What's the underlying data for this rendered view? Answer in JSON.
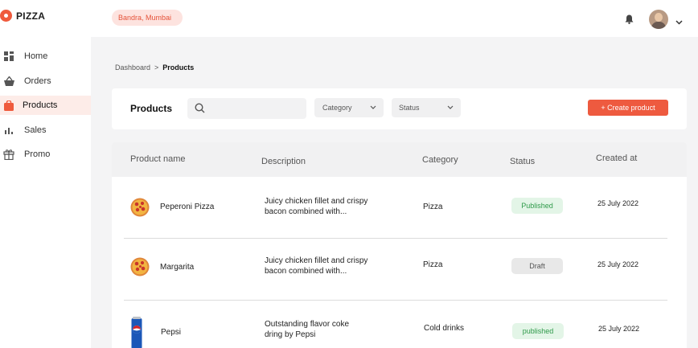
{
  "app": {
    "logo_text": "PIZZA",
    "brand_color": "#ef5a3c"
  },
  "sidebar": {
    "items": [
      {
        "label": "Home",
        "icon": "home-icon",
        "active": false
      },
      {
        "label": "Orders",
        "icon": "basket-icon",
        "active": false
      },
      {
        "label": "Products",
        "icon": "bag-icon",
        "active": true
      },
      {
        "label": "Sales",
        "icon": "bar-chart-icon",
        "active": false
      },
      {
        "label": "Promo",
        "icon": "gift-icon",
        "active": false
      }
    ]
  },
  "topbar": {
    "location": "Bandra, Mumbai"
  },
  "breadcrumb": {
    "root": "Dashboard",
    "separator": ">",
    "current": "Products"
  },
  "toolbar": {
    "title": "Products",
    "search_placeholder": "",
    "category_label": "Category",
    "status_label": "Status",
    "create_label": "+ Create product"
  },
  "table": {
    "headers": {
      "name": "Product name",
      "description": "Description",
      "category": "Category",
      "status": "Status",
      "created": "Created at"
    },
    "rows": [
      {
        "name": "Peperoni Pizza",
        "desc1": "Juicy chicken fillet and crispy",
        "desc2": "bacon combined with...",
        "category": "Pizza",
        "status": "Published",
        "created": "25 July 2022",
        "thumb": "pizza-icon"
      },
      {
        "name": "Margarita",
        "desc1": "Juicy chicken fillet and crispy",
        "desc2": "bacon combined with...",
        "category": "Pizza",
        "status": "Draft",
        "created": "25 July 2022",
        "thumb": "pizza-icon"
      },
      {
        "name": "Pepsi",
        "desc1": "Outstanding flavor coke",
        "desc2": "dring by Pepsi",
        "category": "Cold drinks",
        "status": "published",
        "created": "25 July 2022",
        "thumb": "soda-can-icon"
      }
    ]
  },
  "colors": {
    "published_bg": "#e3f5e7",
    "published_text": "#2f9a4a",
    "draft_bg": "#e8e8e8",
    "accent": "#ee5a3f"
  }
}
